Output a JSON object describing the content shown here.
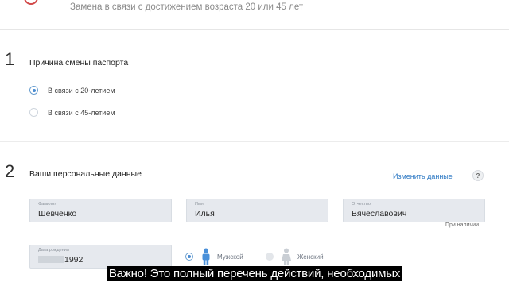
{
  "header": {
    "subtitle": "Замена в связи с достижением возраста 20 или 45 лет"
  },
  "step1": {
    "number": "1",
    "title": "Причина смены паспорта",
    "options": [
      {
        "label": "В связи с 20-летием",
        "checked": true
      },
      {
        "label": "В связи с 45-летием",
        "checked": false
      }
    ]
  },
  "step2": {
    "number": "2",
    "title": "Ваши персональные данные",
    "edit_link": "Изменить данные",
    "help": "?",
    "fields": {
      "surname": {
        "label": "Фамилия",
        "value": "Шевченко"
      },
      "name": {
        "label": "Имя",
        "value": "Илья"
      },
      "patronymic": {
        "label": "Отчество",
        "value": "Вячеславович",
        "note": "При наличии"
      },
      "birthdate": {
        "label": "Дата рождения",
        "value": "1992"
      }
    },
    "gender": {
      "male": {
        "label": "Мужской",
        "checked": true,
        "icon": "male-person-icon",
        "color": "#4a90d9"
      },
      "female": {
        "label": "Женский",
        "checked": false,
        "icon": "female-person-icon",
        "color": "#c9ced4"
      }
    }
  },
  "video_subtitle": "Важно! Это полный перечень действий, необходимых"
}
